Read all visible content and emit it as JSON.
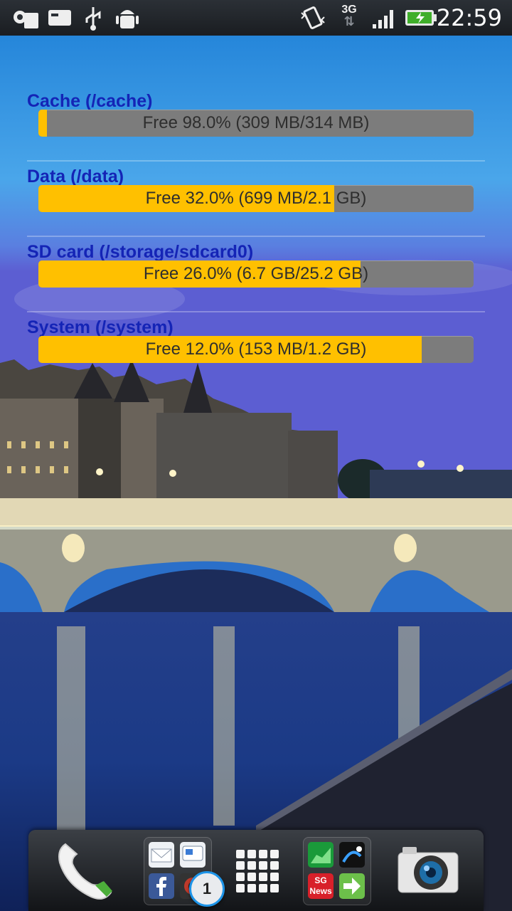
{
  "status_bar": {
    "time": "22:59",
    "network_type": "3G",
    "battery": "charging"
  },
  "storage": [
    {
      "label": "Cache (/cache)",
      "free_percent": 98.0,
      "used_fraction": 0.02,
      "summary": "Free 98.0% (309 MB/314 MB)"
    },
    {
      "label": "Data (/data)",
      "free_percent": 32.0,
      "used_fraction": 0.68,
      "summary": "Free 32.0% (699 MB/2.1 GB)"
    },
    {
      "label": "SD card (/storage/sdcard0)",
      "free_percent": 26.0,
      "used_fraction": 0.74,
      "summary": "Free 26.0% (6.7 GB/25.2 GB)"
    },
    {
      "label": "System (/system)",
      "free_percent": 12.0,
      "used_fraction": 0.88,
      "summary": "Free 12.0% (153 MB/1.2 GB)"
    }
  ],
  "dock": {
    "folder_badge": "1",
    "news_tile": "SG News"
  },
  "colors": {
    "bar_fill": "#ffc000",
    "bar_track": "#7c7c7c",
    "label": "#1424b6"
  }
}
